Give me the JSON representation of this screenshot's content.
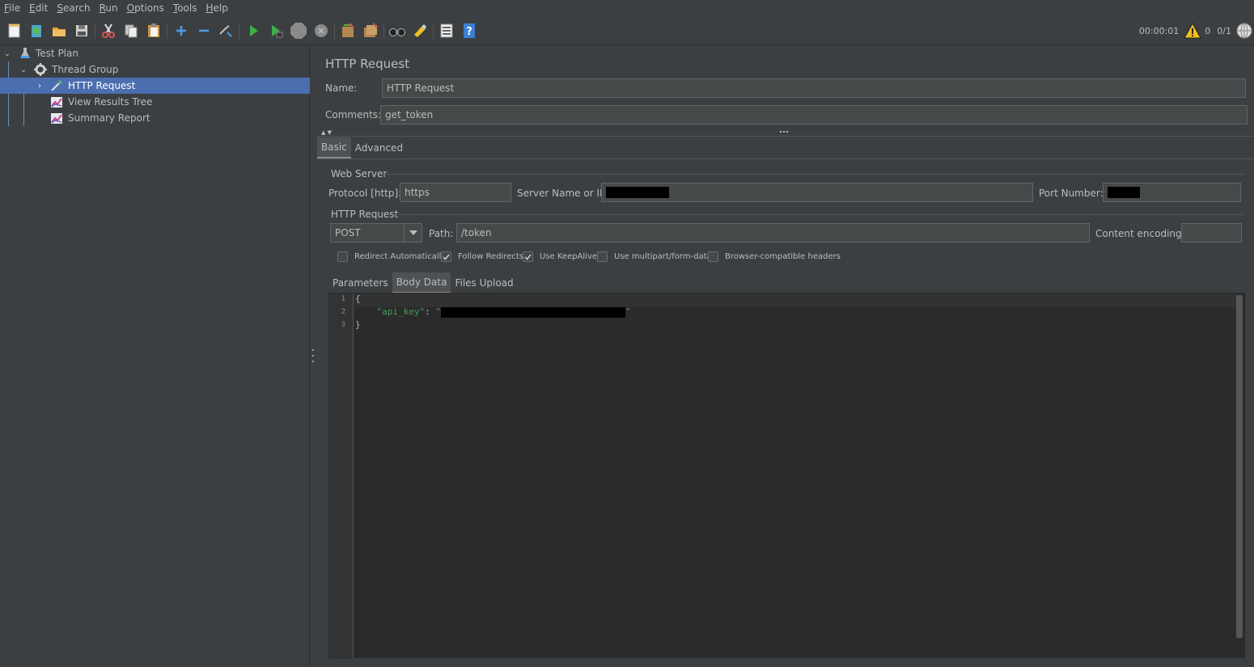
{
  "menu": {
    "items": [
      {
        "label": "File",
        "mnemonic": "F",
        "rest": "ile"
      },
      {
        "label": "Edit",
        "mnemonic": "E",
        "rest": "dit"
      },
      {
        "label": "Search",
        "mnemonic": "S",
        "rest": "earch"
      },
      {
        "label": "Run",
        "mnemonic": "R",
        "rest": "un"
      },
      {
        "label": "Options",
        "mnemonic": "O",
        "rest": "ptions"
      },
      {
        "label": "Tools",
        "mnemonic": "T",
        "rest": "ools"
      },
      {
        "label": "Help",
        "mnemonic": "H",
        "rest": "elp"
      }
    ]
  },
  "toolbar": {
    "elapsed_time": "00:00:01",
    "warning_count": "0",
    "threads": "0/1"
  },
  "tree": {
    "test_plan": "Test Plan",
    "thread_group": "Thread Group",
    "http_request": "HTTP Request",
    "view_results_tree": "View Results Tree",
    "summary_report": "Summary Report"
  },
  "panel": {
    "title": "HTTP Request",
    "name_label": "Name:",
    "name_value": "HTTP Request",
    "comments_label": "Comments:",
    "comments_value": "get_token",
    "tabs": [
      "Basic",
      "Advanced"
    ],
    "web_server": {
      "title": "Web Server",
      "protocol_label": "Protocol [http]:",
      "protocol_value": "https",
      "server_label": "Server Name or IP:",
      "port_label": "Port Number:"
    },
    "http_request": {
      "title": "HTTP Request",
      "method": "POST",
      "path_label": "Path:",
      "path_value": "/token",
      "encoding_label": "Content encoding:",
      "encoding_value": ""
    },
    "checkboxes": {
      "redirect_auto": {
        "label": "Redirect Automatically",
        "checked": false
      },
      "follow_redirects": {
        "label": "Follow Redirects",
        "checked": true
      },
      "keepalive": {
        "label": "Use KeepAlive",
        "checked": true
      },
      "multipart": {
        "label": "Use multipart/form-data",
        "checked": false
      },
      "browser_headers": {
        "label": "Browser-compatible headers",
        "checked": false
      }
    },
    "body_tabs": [
      "Parameters",
      "Body Data",
      "Files Upload"
    ],
    "body": {
      "line_numbers": [
        "1",
        "2",
        "3"
      ],
      "line1": "{",
      "line2_key": "\"api_key\"",
      "line2_colon": ": ",
      "line2_quote_open": "\"",
      "line2_quote_close": "\"",
      "line3": "}"
    }
  }
}
